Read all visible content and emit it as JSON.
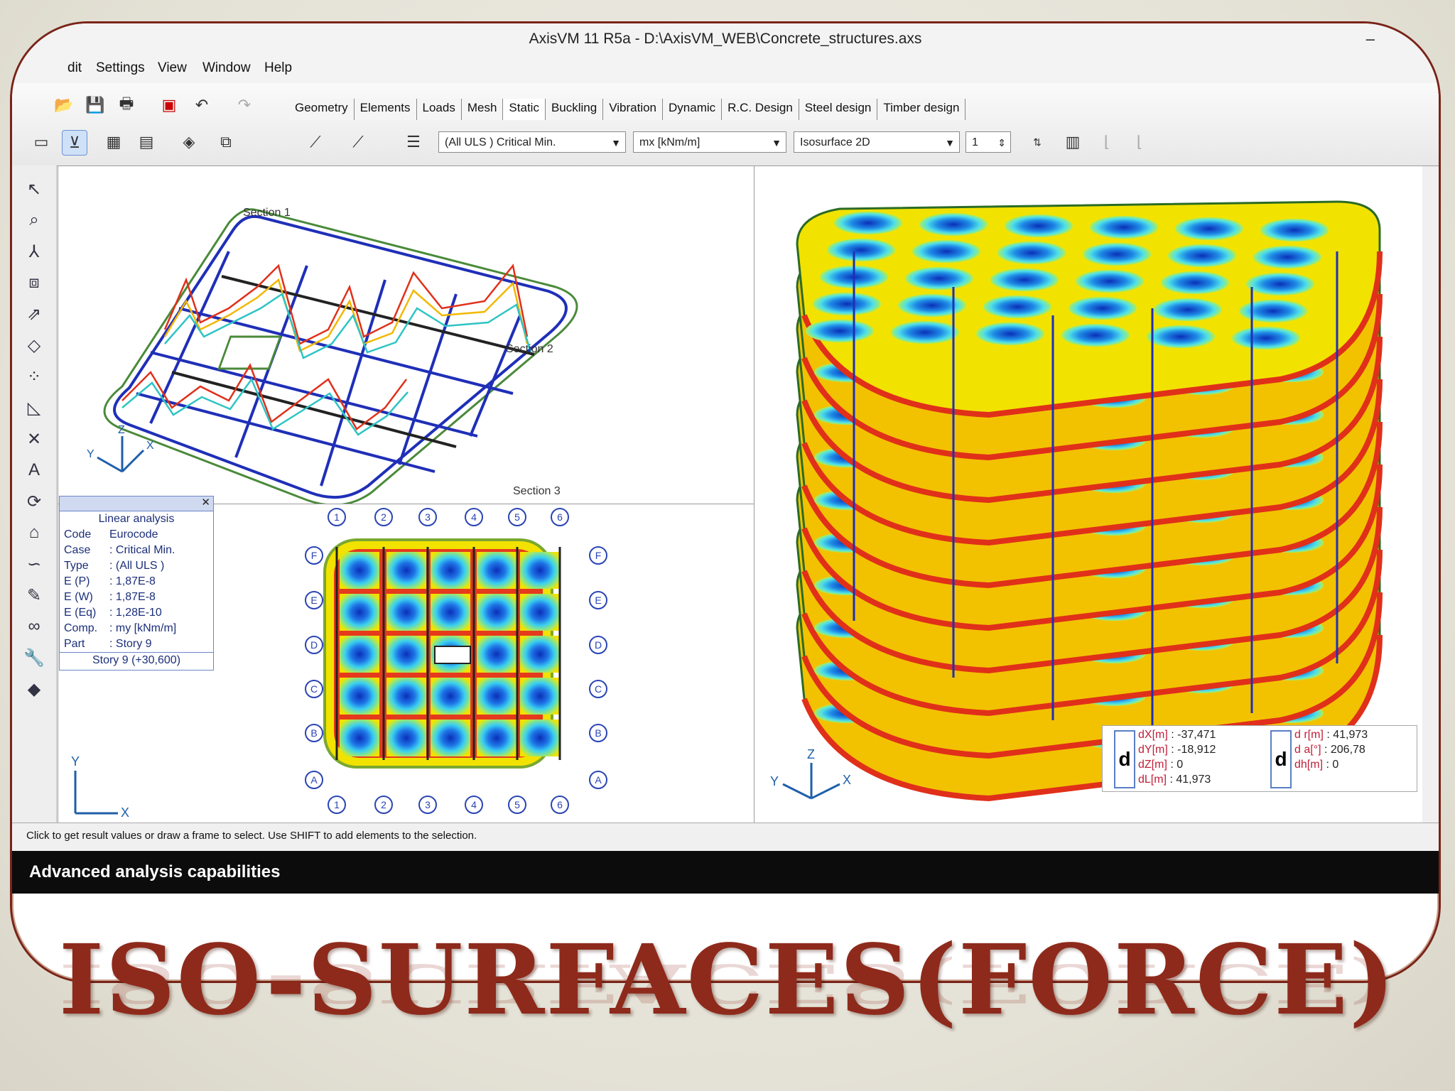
{
  "window": {
    "title": "AxisVM 11 R5a - D:\\AxisVM_WEB\\Concrete_structures.axs",
    "minimize": "–",
    "close": "✕"
  },
  "menu": [
    "dit",
    "Settings",
    "View",
    "Window",
    "Help"
  ],
  "tabs": [
    "Geometry",
    "Elements",
    "Loads",
    "Mesh",
    "Static",
    "Buckling",
    "Vibration",
    "Dynamic",
    "R.C. Design",
    "Steel design",
    "Timber design"
  ],
  "active_tab": "Static",
  "toolbar": {
    "load_case": "(All ULS ) Critical Min.",
    "component": "mx [kNm/m]",
    "display_mode": "Isosurface 2D",
    "scale": "1"
  },
  "info_panel": {
    "title": "Linear analysis",
    "rows": [
      {
        "key": "Code",
        "value": "Eurocode"
      },
      {
        "key": "Case",
        "value": ": Critical Min."
      },
      {
        "key": "Type",
        "value": ": (All ULS )"
      },
      {
        "key": "E (P)",
        "value": ": 1,87E-8"
      },
      {
        "key": "E (W)",
        "value": ": 1,87E-8"
      },
      {
        "key": "E (Eq)",
        "value": ": 1,28E-10"
      },
      {
        "key": "Comp.",
        "value": ": my [kNm/m]"
      },
      {
        "key": "Part",
        "value": ": Story 9"
      }
    ],
    "footer": "Story 9 (+30,600)"
  },
  "coords": {
    "d_label": "d",
    "left": [
      {
        "label": "dX[m]",
        "value": ": -37,471"
      },
      {
        "label": "dY[m]",
        "value": ": -18,912"
      },
      {
        "label": "dZ[m]",
        "value": ": 0"
      },
      {
        "label": "dL[m]",
        "value": ": 41,973"
      }
    ],
    "right": [
      {
        "label": "d r[m]",
        "value": ": 41,973"
      },
      {
        "label": "d a[°]",
        "value": ": 206,78"
      },
      {
        "label": "dh[m]",
        "value": ": 0"
      }
    ]
  },
  "axes": {
    "x": "X",
    "y": "Y",
    "z": "Z"
  },
  "plan_grid": {
    "cols": [
      "1",
      "2",
      "3",
      "4",
      "5",
      "6"
    ],
    "rows": [
      "F",
      "E",
      "D",
      "C",
      "B",
      "A"
    ]
  },
  "section_labels": [
    "Section 1",
    "Section 2",
    "Section 3"
  ],
  "status_text": "Click to get result values or draw a frame to select. Use SHIFT to add elements to the selection.",
  "caption": "Advanced analysis capabilities",
  "headline": "ISO-SURFACES(FORCE)",
  "colors": {
    "brand_red": "#8e2a1b",
    "frame_border": "#7a2318",
    "beam_blue": "#1f2fb8",
    "iso_red": "#e0301a",
    "iso_yellow": "#f2e200",
    "iso_blue": "#1546d6"
  }
}
